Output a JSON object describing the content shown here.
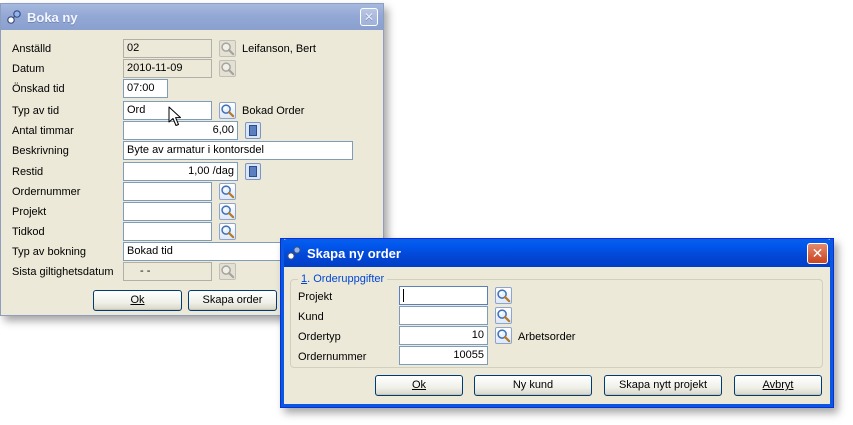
{
  "boka_window": {
    "title": "Boka ny",
    "close_glyph": "✕",
    "fields": {
      "anstalld": {
        "label": "Anställd",
        "value": "02",
        "extra": "Leifanson, Bert"
      },
      "datum": {
        "label": "Datum",
        "value": "2010-11-09"
      },
      "onskad_tid": {
        "label": "Önskad tid",
        "value": "07:00"
      },
      "typ_av_tid": {
        "label": "Typ av tid",
        "value": "Ord",
        "extra": "Bokad Order"
      },
      "antal_timmar": {
        "label": "Antal timmar",
        "value": "6,00"
      },
      "beskrivning": {
        "label": "Beskrivning",
        "value": "Byte av armatur i kontorsdel"
      },
      "restid": {
        "label": "Restid",
        "value": "1,00 /dag"
      },
      "ordernummer": {
        "label": "Ordernummer",
        "value": ""
      },
      "projekt": {
        "label": "Projekt",
        "value": ""
      },
      "tidkod": {
        "label": "Tidkod",
        "value": ""
      },
      "typ_av_bokning": {
        "label": "Typ av bokning",
        "value": "Bokad tid"
      },
      "sista_giltighetsdatum": {
        "label": "Sista giltighetsdatum",
        "value": "-  -"
      }
    },
    "buttons": {
      "ok": "Ok",
      "skapa_order": "Skapa order"
    }
  },
  "skapa_window": {
    "title": "Skapa ny order",
    "close_glyph": "✕",
    "group": {
      "number": "1",
      "label": ". Orderuppgifter"
    },
    "fields": {
      "projekt": {
        "label": "Projekt",
        "value": ""
      },
      "kund": {
        "label": "Kund",
        "value": ""
      },
      "ordertyp": {
        "label": "Ordertyp",
        "value": "10",
        "extra": "Arbetsorder"
      },
      "ordernummer": {
        "label": "Ordernummer",
        "value": "10055"
      }
    },
    "buttons": {
      "ok": "Ok",
      "ny_kund": "Ny kund",
      "skapa_nytt_projekt": "Skapa nytt projekt",
      "avbryt": "Avbryt"
    }
  },
  "icons": {
    "lookup": "magnifier-icon",
    "calculator": "calculator-icon",
    "app": "app-icon",
    "cursor": "mouse-pointer-icon"
  },
  "colors": {
    "dialog_bg": "#ece9d8",
    "active_title": "#0347d6",
    "inactive_title": "#93a8d4",
    "group_label": "#0046d5",
    "close_red": "#c9431f"
  }
}
